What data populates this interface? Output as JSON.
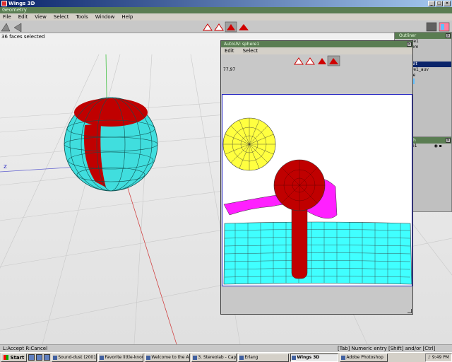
{
  "window": {
    "title": "Wings 3D"
  },
  "mode_bar": "Geometry",
  "menu": [
    "File",
    "Edit",
    "View",
    "Select",
    "Tools",
    "Window",
    "Help"
  ],
  "selection_status": "36 faces selected",
  "axis_label": "Z",
  "outliner": {
    "title": "Outliner",
    "items": [
      "re1",
      "om",
      "",
      "",
      "ult",
      "re1_auv",
      "ie"
    ],
    "selected_index": 4
  },
  "geometry_graph": {
    "title": "y Graph",
    "item": "e1"
  },
  "autouv": {
    "title": "AutoUV: sphere1",
    "menu": [
      "Edit",
      "Select"
    ],
    "coord_readout": "77,97"
  },
  "status_bar": {
    "left": "L:Accept  R:Cancel",
    "right": "[Tab] Numeric entry  [Shift] and/or [Ctrl] Constrain"
  },
  "taskbar": {
    "start": "Start",
    "items": [
      "Sound-dust (2001)",
      "Favorite little-know...",
      "Welcome to the Art ...",
      "3. Stereolab - Capt...",
      "Erlang",
      "Wings 3D",
      "Adobe Photoshop"
    ],
    "active_index": 5,
    "clock": "9:49 PM"
  },
  "colors": {
    "mode_bar": "#5a7d52",
    "sphere_cyan": "#40e0e0",
    "sphere_red": "#c00000",
    "uv_yellow": "#ffff40",
    "uv_magenta": "#ff20ff"
  }
}
